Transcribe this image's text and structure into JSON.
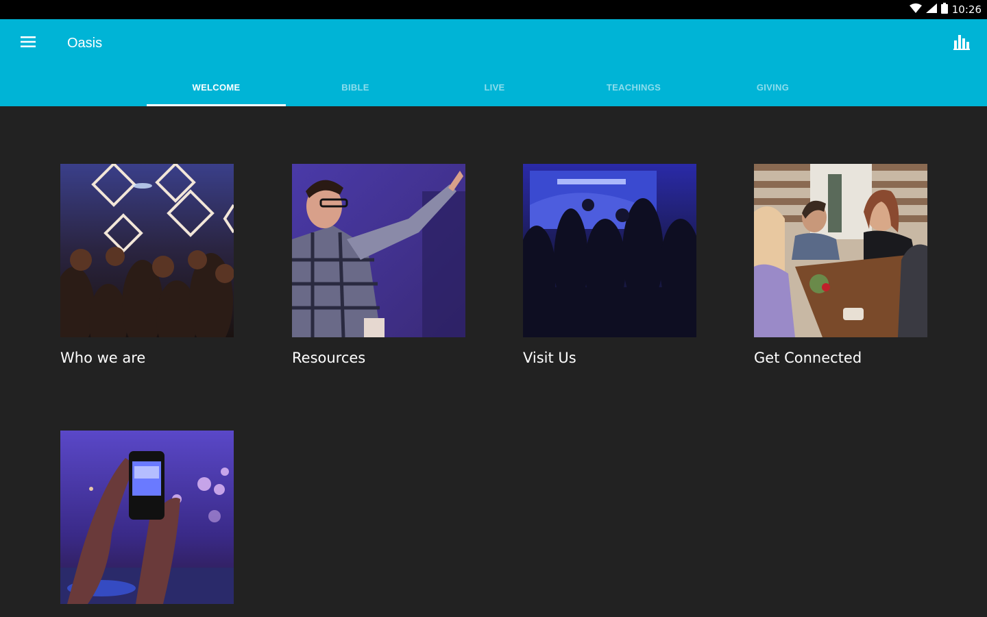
{
  "status": {
    "time": "10:26"
  },
  "app": {
    "title": "Oasis"
  },
  "tabs": [
    {
      "label": "WELCOME"
    },
    {
      "label": "BIBLE"
    },
    {
      "label": "LIVE"
    },
    {
      "label": "TEACHINGS"
    },
    {
      "label": "GIVING"
    }
  ],
  "cards": [
    {
      "label": "Who we are"
    },
    {
      "label": "Resources"
    },
    {
      "label": "Visit Us"
    },
    {
      "label": "Get Connected"
    },
    {
      "label": ""
    }
  ],
  "colors": {
    "appbar": "#00b4d6",
    "background": "#222222",
    "statusbar": "#000000"
  }
}
